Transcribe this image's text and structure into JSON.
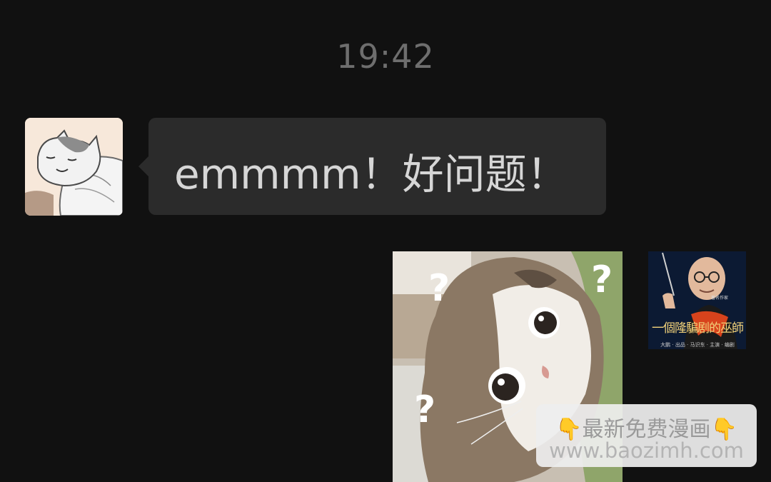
{
  "chat": {
    "timestamp": "19:42",
    "incoming_message": {
      "avatar_icon": "cat-sleeping-avatar",
      "text": "emmmm！好问题！"
    },
    "outgoing_message": {
      "sticker_icon": "confused-cat-sticker",
      "question_mark": "?",
      "avatar_icon": "man-portrait-avatar",
      "avatar_title": "一個隆騙剧的巫師",
      "avatar_credit": "大鹏 · 出品 · 马识东 · 主演 · 编剧",
      "avatar_small_text": "著名作家"
    }
  },
  "watermark": {
    "emoji": "👇",
    "line1": "最新免费漫画",
    "line2": "www.baozimh.com"
  },
  "colors": {
    "background": "#111111",
    "bubble": "#2b2b2b",
    "bubble_text": "#d6d6d6",
    "timestamp": "#6e6e6e"
  }
}
